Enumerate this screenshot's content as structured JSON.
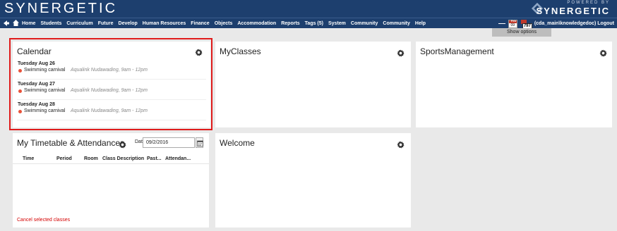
{
  "header": {
    "logo": "SYNERGETIC",
    "powered_by": "POWERED BY",
    "powered_name": "SYNERGETIC"
  },
  "nav": {
    "items": [
      "Home",
      "Students",
      "Curriculum",
      "Future",
      "Develop",
      "Human Resources",
      "Finance",
      "Objects",
      "Accommodation",
      "Reports",
      "Tags (5)",
      "System",
      "Community",
      "Community",
      "Help"
    ],
    "calendar_badge": "09",
    "calendar_month": "Feb",
    "notification_count": "797",
    "user": "(cda_main\\knowledgedoc) Logout"
  },
  "show_options": "Show options",
  "calendar": {
    "title": "Calendar",
    "entries": [
      {
        "date": "Tuesday Aug 26",
        "event": "Swimming carnival",
        "location": "Aqualink Nudawading, 9am - 12pm"
      },
      {
        "date": "Tuesday Aug 27",
        "event": "Swimming carnival",
        "location": "Aqualink Nudawading, 9am - 12pm"
      },
      {
        "date": "Tuesday Aug 28",
        "event": "Swimming carnival",
        "location": "Aqualink Nudawading, 9am - 12pm"
      }
    ]
  },
  "myclasses": {
    "title": "MyClasses"
  },
  "sports": {
    "title": "SportsManagement"
  },
  "timetable": {
    "title": "My Timetable & Attendances",
    "date_label": "Date:",
    "date_value": "09/2/2016",
    "columns": [
      "Time",
      "Period",
      "Room",
      "Class Description",
      "Past...",
      "Attendan..."
    ],
    "cancel_label": "Cancel selected classes"
  },
  "welcome": {
    "title": "Welcome"
  },
  "colors": {
    "header": "#1d3f6e",
    "highlight": "#e01b1b",
    "event_dot": "#e8533a",
    "cancel": "#d40000"
  }
}
